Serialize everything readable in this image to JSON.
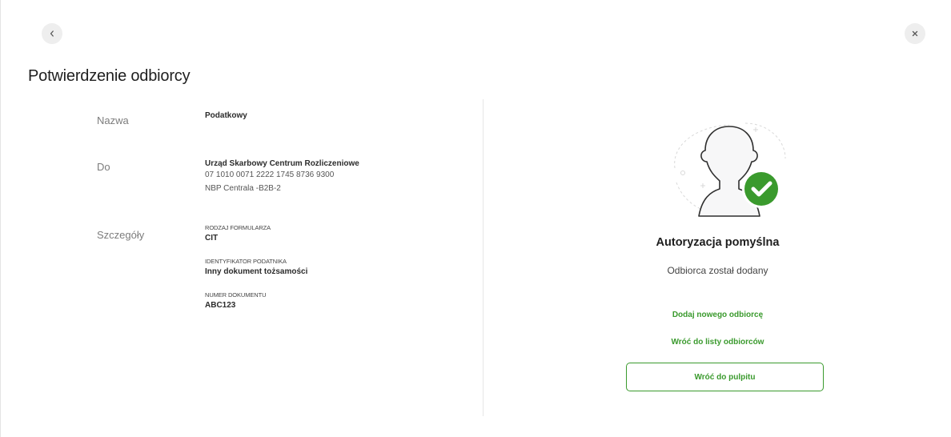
{
  "page": {
    "title": "Potwierdzenie odbiorcy"
  },
  "nav": {
    "back_icon": "chevron-left-icon",
    "close_icon": "close-icon"
  },
  "details": {
    "name_label": "Nazwa",
    "name_value": "Podatkowy",
    "to_label": "Do",
    "to_title": "Urząd Skarbowy Centrum Rozliczeniowe",
    "to_account": "07 1010 0071 2222 1745 8736 9300",
    "to_bank": "NBP Centrala -B2B-2",
    "details_label": "Szczegóły",
    "form_type_label": "RODZAJ FORMULARZA",
    "form_type_value": "CIT",
    "taxpayer_id_label": "IDENTYFIKATOR PODATNIKA",
    "taxpayer_id_value": "Inny dokument tożsamości",
    "doc_number_label": "NUMER DOKUMENTU",
    "doc_number_value": "ABC123"
  },
  "result": {
    "title": "Autoryzacja pomyślna",
    "subtitle": "Odbiorca został dodany",
    "add_new_link": "Dodaj nowego odbiorcę",
    "back_to_list_link": "Wróć do listy odbiorców",
    "back_to_dashboard_button": "Wróć do pulpitu",
    "success_color": "#3a9a2d",
    "illustration_icon": "user-success-icon"
  }
}
